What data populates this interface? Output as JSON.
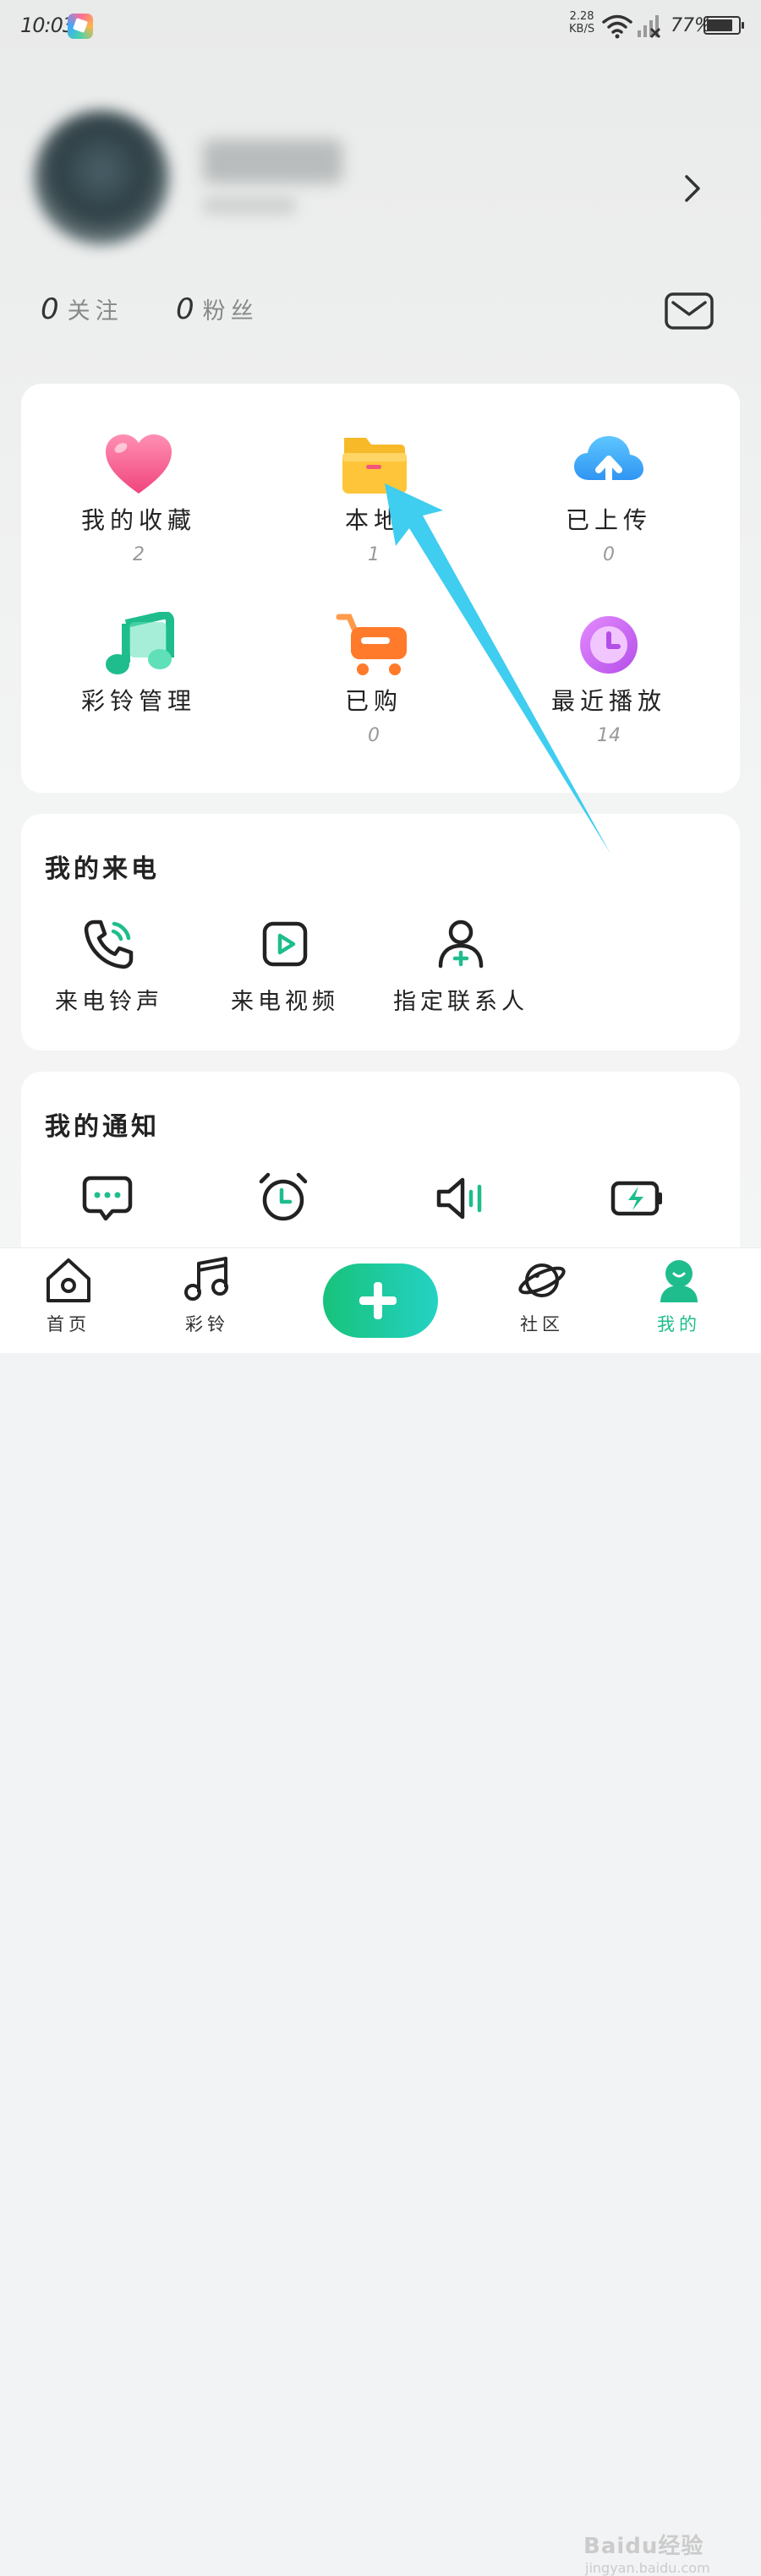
{
  "status_bar": {
    "time": "10:03",
    "net_speed_value": "2.28",
    "net_speed_unit": "KB/S",
    "battery": "77%"
  },
  "profile": {
    "following_count": "0",
    "following_label": "关注",
    "fans_count": "0",
    "fans_label": "粉丝"
  },
  "library": {
    "items": [
      {
        "label": "我的收藏",
        "count": "2",
        "icon": "heart-icon"
      },
      {
        "label": "本地",
        "count": "1",
        "icon": "folder-icon"
      },
      {
        "label": "已上传",
        "count": "0",
        "icon": "cloud-upload-icon"
      },
      {
        "label": "彩铃管理",
        "count": "",
        "icon": "music-note-icon"
      },
      {
        "label": "已购",
        "count": "0",
        "icon": "cart-icon"
      },
      {
        "label": "最近播放",
        "count": "14",
        "icon": "clock-icon"
      }
    ]
  },
  "my_calls": {
    "title": "我的来电",
    "items": [
      {
        "label": "来电铃声",
        "icon": "phone-ring-icon"
      },
      {
        "label": "来电视频",
        "icon": "video-play-icon"
      },
      {
        "label": "指定联系人",
        "icon": "add-contact-icon"
      }
    ]
  },
  "my_notifications": {
    "title": "我的通知",
    "items": [
      {
        "icon": "message-icon"
      },
      {
        "icon": "alarm-icon"
      },
      {
        "icon": "speaker-icon"
      },
      {
        "icon": "battery-charging-icon"
      }
    ]
  },
  "tabbar": {
    "items": [
      {
        "label": "首页",
        "icon": "home-icon"
      },
      {
        "label": "彩铃",
        "icon": "music-icon"
      },
      {
        "label": "",
        "icon": "plus-icon"
      },
      {
        "label": "社区",
        "icon": "planet-icon"
      },
      {
        "label": "我的",
        "icon": "profile-icon"
      }
    ]
  },
  "watermark": {
    "text": "Baidu经验",
    "url_text": "jingyan.baidu.com"
  },
  "colors": {
    "accent": "#1fbd8d",
    "arrow": "#3fcdf0"
  }
}
